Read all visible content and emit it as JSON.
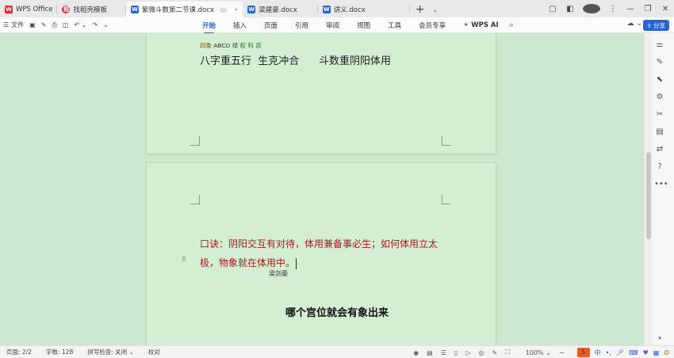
{
  "tabs": [
    {
      "label": "WPS Office",
      "icon": "wps-logo-icon"
    },
    {
      "label": "找稻壳模板",
      "icon": "template-icon"
    },
    {
      "label": "紫微斗数第二节课.docx",
      "icon": "doc-icon",
      "active": true
    },
    {
      "label": "梁建豪.docx",
      "icon": "doc-icon"
    },
    {
      "label": "讲义.docx",
      "icon": "doc-icon"
    }
  ],
  "menubar": {
    "file_label": "文件",
    "items": [
      "开始",
      "插入",
      "页面",
      "引用",
      "审阅",
      "视图",
      "工具",
      "会员专享"
    ],
    "ai_label": "WPS AI",
    "share_label": "分享"
  },
  "document": {
    "page1": {
      "small_line_prefix": "四象",
      "small_line_abcd": "ABCD",
      "small_line_rest": "禄 权 科 忌",
      "big_line": "八字重五行  生克冲合      斗数重阴阳体用"
    },
    "page2": {
      "verse": "口诀：阴阳交互有对待，体用兼备事必生；如何体用立太极，物象就在体用中。",
      "author": "梁剑豪"
    }
  },
  "subtitle": "哪个宫位就会有象出来",
  "status": {
    "page": "页面: 2/2",
    "word_count": "字数: 128",
    "spell_check": "拼写检查: 关闭",
    "proofread": "校对",
    "zoom": "100%"
  },
  "ime": {
    "logo": "S",
    "lang": "中"
  }
}
